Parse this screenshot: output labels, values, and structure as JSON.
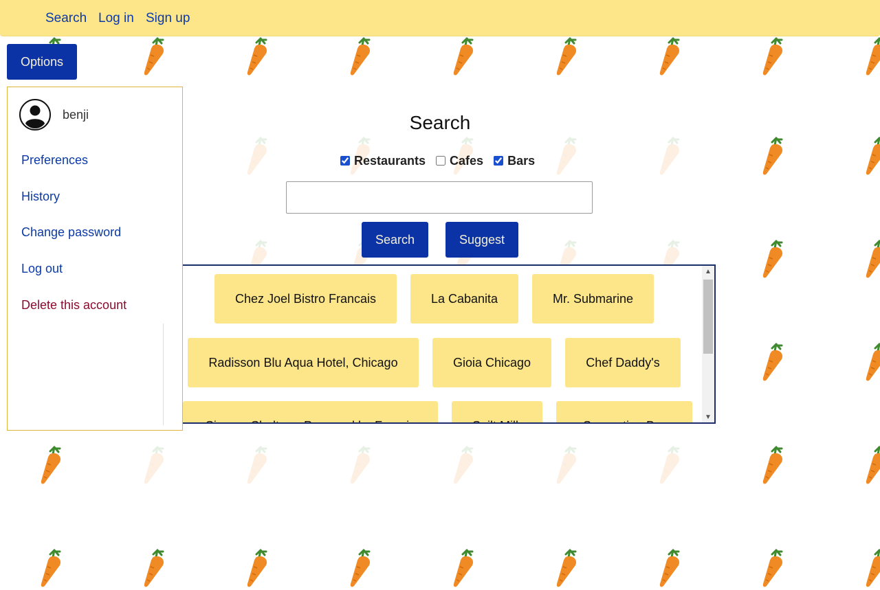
{
  "nav": {
    "search_label": "Search",
    "login_label": "Log in",
    "signup_label": "Sign up"
  },
  "options_button": "Options",
  "user_panel": {
    "username": "benji",
    "menu": [
      {
        "label": "Preferences"
      },
      {
        "label": "History"
      },
      {
        "label": "Change password"
      },
      {
        "label": "Log out"
      },
      {
        "label": "Delete this account"
      }
    ]
  },
  "search": {
    "title": "Search",
    "filters": [
      {
        "label": "Restaurants",
        "checked": true
      },
      {
        "label": "Cafes",
        "checked": false
      },
      {
        "label": "Bars",
        "checked": true
      }
    ],
    "input_value": "",
    "search_button": "Search",
    "suggest_button": "Suggest"
  },
  "results": [
    "Chez Joel Bistro Francais",
    "La Cabanita",
    "Mr. Submarine",
    "Radisson Blu Aqua Hotel, Chicago",
    "Gioia Chicago",
    "Chef Daddy's",
    "Simone Shelton - Prepared by Francis",
    "Spilt Milk",
    "Serpentine Bar"
  ],
  "colors": {
    "nav_bg": "#fde68a",
    "primary_button": "#0b33a6",
    "card_bg": "#fde68a",
    "link": "#0b3aa8",
    "danger_link": "#8a0b2e"
  },
  "background_icon": "carrot-icon"
}
